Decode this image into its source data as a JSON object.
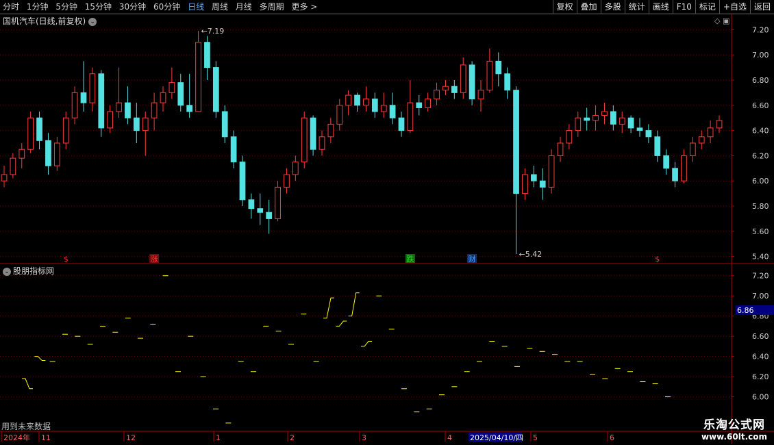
{
  "toolbar": {
    "periods": [
      "分时",
      "1分钟",
      "5分钟",
      "15分钟",
      "30分钟",
      "60分钟",
      "日线",
      "周线",
      "月线",
      "多周期",
      "更多 >"
    ],
    "active": "日线",
    "actions": [
      "复权",
      "叠加",
      "多股",
      "统计",
      "画线",
      "F10",
      "标记",
      "+自选",
      "返回"
    ]
  },
  "stock_title": "国机汽车(日线,前复权)",
  "indicator_title": "股朋指标网",
  "future_note": "用到未来数据",
  "brand": {
    "name": "乐淘公式网",
    "url": "www.60lt.com"
  },
  "colors": {
    "up": "#ff3d3d",
    "down": "#54e1e1",
    "grid": "#7a0000",
    "axis_text": "#d0d0d0",
    "indicator": "#ffff00",
    "price_box": "#000080"
  },
  "chart_data": [
    {
      "type": "candlestick",
      "yticks": [
        5.4,
        5.6,
        5.8,
        6.0,
        6.2,
        6.4,
        6.6,
        6.8,
        7.0,
        7.2
      ],
      "ylim": [
        5.36,
        7.24
      ],
      "annotations": [
        {
          "label": "7.19",
          "value": 7.19
        },
        {
          "label": "5.42",
          "value": 5.42
        }
      ],
      "markers": [
        "$",
        "涨",
        "跌",
        "财",
        "$"
      ],
      "ohlc": [
        [
          6.0,
          6.12,
          5.95,
          6.05
        ],
        [
          6.05,
          6.22,
          6.02,
          6.18
        ],
        [
          6.18,
          6.3,
          6.1,
          6.25
        ],
        [
          6.25,
          6.55,
          6.22,
          6.5
        ],
        [
          6.5,
          6.55,
          6.25,
          6.32
        ],
        [
          6.32,
          6.38,
          6.05,
          6.12
        ],
        [
          6.12,
          6.35,
          6.08,
          6.3
        ],
        [
          6.3,
          6.55,
          6.25,
          6.5
        ],
        [
          6.5,
          6.75,
          6.45,
          6.7
        ],
        [
          6.7,
          6.95,
          6.55,
          6.62
        ],
        [
          6.62,
          6.9,
          6.55,
          6.85
        ],
        [
          6.85,
          6.88,
          6.35,
          6.42
        ],
        [
          6.42,
          6.6,
          6.38,
          6.55
        ],
        [
          6.55,
          6.9,
          6.5,
          6.62
        ],
        [
          6.62,
          6.75,
          6.45,
          6.5
        ],
        [
          6.5,
          6.62,
          6.3,
          6.4
        ],
        [
          6.4,
          6.55,
          6.2,
          6.5
        ],
        [
          6.5,
          6.7,
          6.4,
          6.62
        ],
        [
          6.62,
          6.75,
          6.55,
          6.7
        ],
        [
          6.7,
          6.9,
          6.65,
          6.78
        ],
        [
          6.78,
          6.85,
          6.55,
          6.6
        ],
        [
          6.6,
          6.85,
          6.5,
          6.55
        ],
        [
          6.55,
          7.19,
          6.55,
          7.1
        ],
        [
          7.1,
          7.15,
          6.8,
          6.9
        ],
        [
          6.9,
          6.95,
          6.5,
          6.55
        ],
        [
          6.55,
          6.6,
          6.3,
          6.35
        ],
        [
          6.35,
          6.4,
          6.1,
          6.15
        ],
        [
          6.15,
          6.2,
          5.8,
          5.85
        ],
        [
          5.85,
          5.9,
          5.7,
          5.78
        ],
        [
          5.78,
          5.9,
          5.65,
          5.75
        ],
        [
          5.75,
          5.85,
          5.58,
          5.7
        ],
        [
          5.7,
          6.0,
          5.68,
          5.95
        ],
        [
          5.95,
          6.1,
          5.9,
          6.05
        ],
        [
          6.05,
          6.2,
          6.0,
          6.15
        ],
        [
          6.15,
          6.55,
          6.1,
          6.5
        ],
        [
          6.5,
          6.52,
          6.2,
          6.25
        ],
        [
          6.25,
          6.4,
          6.2,
          6.35
        ],
        [
          6.35,
          6.5,
          6.3,
          6.45
        ],
        [
          6.45,
          6.65,
          6.4,
          6.6
        ],
        [
          6.6,
          6.72,
          6.52,
          6.68
        ],
        [
          6.68,
          6.7,
          6.55,
          6.6
        ],
        [
          6.6,
          6.75,
          6.55,
          6.65
        ],
        [
          6.65,
          6.7,
          6.5,
          6.55
        ],
        [
          6.55,
          6.7,
          6.5,
          6.6
        ],
        [
          6.6,
          6.7,
          6.45,
          6.5
        ],
        [
          6.5,
          6.55,
          6.35,
          6.4
        ],
        [
          6.4,
          6.8,
          6.38,
          6.62
        ],
        [
          6.62,
          6.68,
          6.52,
          6.58
        ],
        [
          6.58,
          6.7,
          6.55,
          6.65
        ],
        [
          6.65,
          6.78,
          6.6,
          6.72
        ],
        [
          6.72,
          6.8,
          6.68,
          6.75
        ],
        [
          6.75,
          6.8,
          6.65,
          6.7
        ],
        [
          6.7,
          6.98,
          6.65,
          6.92
        ],
        [
          6.92,
          6.95,
          6.6,
          6.65
        ],
        [
          6.65,
          6.8,
          6.55,
          6.72
        ],
        [
          6.72,
          7.05,
          6.7,
          6.95
        ],
        [
          6.95,
          7.02,
          6.75,
          6.85
        ],
        [
          6.85,
          6.9,
          6.65,
          6.72
        ],
        [
          6.72,
          6.75,
          5.42,
          5.9
        ],
        [
          5.9,
          6.1,
          5.85,
          6.05
        ],
        [
          6.05,
          6.12,
          5.95,
          6.0
        ],
        [
          6.0,
          6.1,
          5.85,
          5.95
        ],
        [
          5.95,
          6.25,
          5.9,
          6.2
        ],
        [
          6.2,
          6.35,
          6.15,
          6.3
        ],
        [
          6.3,
          6.45,
          6.25,
          6.4
        ],
        [
          6.4,
          6.55,
          6.35,
          6.5
        ],
        [
          6.5,
          6.58,
          6.4,
          6.48
        ],
        [
          6.48,
          6.6,
          6.4,
          6.52
        ],
        [
          6.52,
          6.62,
          6.45,
          6.55
        ],
        [
          6.55,
          6.6,
          6.4,
          6.45
        ],
        [
          6.45,
          6.55,
          6.38,
          6.5
        ],
        [
          6.5,
          6.52,
          6.38,
          6.42
        ],
        [
          6.42,
          6.5,
          6.35,
          6.4
        ],
        [
          6.4,
          6.45,
          6.3,
          6.35
        ],
        [
          6.35,
          6.4,
          6.15,
          6.2
        ],
        [
          6.2,
          6.25,
          6.05,
          6.1
        ],
        [
          6.1,
          6.15,
          5.95,
          6.0
        ],
        [
          6.0,
          6.25,
          5.98,
          6.2
        ],
        [
          6.2,
          6.35,
          6.15,
          6.3
        ],
        [
          6.3,
          6.4,
          6.25,
          6.35
        ],
        [
          6.35,
          6.48,
          6.3,
          6.42
        ],
        [
          6.42,
          6.52,
          6.38,
          6.48
        ]
      ]
    },
    {
      "type": "scatter",
      "title": "股朋指标网",
      "yticks": [
        6.0,
        6.2,
        6.4,
        6.6,
        6.8,
        7.0,
        7.2
      ],
      "ylim": [
        5.78,
        7.3
      ],
      "current_value": "6.86",
      "segments": [
        [
          6.18,
          6.08
        ],
        [
          6.4,
          6.36
        ],
        [
          6.35
        ],
        [
          6.62
        ],
        [
          6.6
        ],
        [
          6.52
        ],
        [
          6.7
        ],
        [
          6.64
        ],
        [
          6.78
        ],
        [
          6.58
        ],
        [
          6.72
        ],
        [
          7.2
        ],
        [
          6.25
        ],
        [
          6.6
        ],
        [
          6.2
        ],
        [
          5.88
        ],
        [
          5.74
        ],
        [
          6.35
        ],
        [
          6.25
        ],
        [
          6.7
        ],
        [
          6.65
        ],
        [
          6.52
        ],
        [
          6.82
        ],
        [
          6.35
        ],
        [
          6.78,
          6.98
        ],
        [
          6.7,
          6.75
        ],
        [
          6.8,
          7.03
        ],
        [
          6.5,
          6.55
        ],
        [
          7.0
        ],
        [
          6.67
        ],
        [
          6.08
        ],
        [
          5.85
        ],
        [
          5.88
        ],
        [
          6.02
        ],
        [
          6.1
        ],
        [
          6.25
        ],
        [
          6.35
        ],
        [
          6.55
        ],
        [
          6.5
        ],
        [
          6.3
        ],
        [
          6.48
        ],
        [
          6.45
        ],
        [
          6.42
        ],
        [
          6.35
        ],
        [
          6.35
        ],
        [
          6.22
        ],
        [
          6.18
        ],
        [
          6.28
        ],
        [
          6.25
        ],
        [
          6.15
        ],
        [
          6.13
        ],
        [
          6.0
        ]
      ]
    }
  ],
  "x_axis": {
    "labels": [
      "2024年",
      "11",
      "12",
      "1",
      "2",
      "3",
      "4",
      "5",
      "6"
    ],
    "cursor_date": "2025/04/10/四"
  }
}
